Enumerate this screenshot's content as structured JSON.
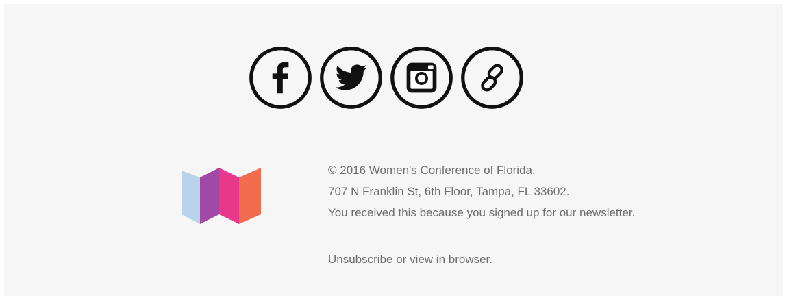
{
  "social": [
    {
      "name": "Facebook",
      "icon": "facebook-icon"
    },
    {
      "name": "Twitter",
      "icon": "twitter-icon"
    },
    {
      "name": "Instagram",
      "icon": "instagram-icon"
    },
    {
      "name": "Website",
      "icon": "link-icon"
    }
  ],
  "logo": {
    "name": "Women's Conference of Florida logo",
    "colors": [
      "#b9d3ea",
      "#a049a6",
      "#e8388c",
      "#f26d4d"
    ]
  },
  "footer": {
    "copyright": "© 2016 Women's Conference of Florida.",
    "address": "707 N Franklin St, 6th Floor, Tampa, FL 33602.",
    "reason": "You received this because you signed up for our newsletter.",
    "unsubscribe_label": "Unsubscribe",
    "connector": " or ",
    "view_in_browser_label": "view in browser",
    "period": "."
  },
  "colors": {
    "panel_background": "#f6f6f6",
    "text": "#6d6d6d",
    "icon": "#111111"
  }
}
